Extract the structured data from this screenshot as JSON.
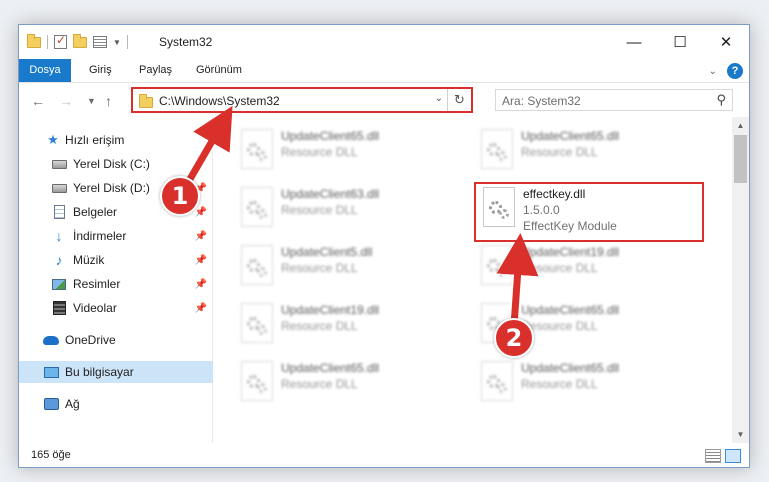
{
  "window": {
    "title": "System32",
    "controls": {
      "minimize": "—",
      "maximize": "☐",
      "close": "✕"
    }
  },
  "ribbon": {
    "tabs": [
      "Dosya",
      "Giriş",
      "Paylaş",
      "Görünüm"
    ],
    "help": "?"
  },
  "address": {
    "path": "C:\\Windows\\System32",
    "search_placeholder": "Ara: System32"
  },
  "sidebar": {
    "items": [
      {
        "label": "Hızlı erişim",
        "icon": "star-icon",
        "pinned": false
      },
      {
        "label": "Yerel Disk (C:)",
        "icon": "drive-icon",
        "pinned": true
      },
      {
        "label": "Yerel Disk (D:)",
        "icon": "drive-icon",
        "pinned": true
      },
      {
        "label": "Belgeler",
        "icon": "documents-icon",
        "pinned": true
      },
      {
        "label": "İndirmeler",
        "icon": "downloads-icon",
        "pinned": true
      },
      {
        "label": "Müzik",
        "icon": "music-icon",
        "pinned": true
      },
      {
        "label": "Resimler",
        "icon": "pictures-icon",
        "pinned": true
      },
      {
        "label": "Videolar",
        "icon": "videos-icon",
        "pinned": true
      },
      {
        "label": "OneDrive",
        "icon": "onedrive-icon",
        "pinned": false
      },
      {
        "label": "Bu bilgisayar",
        "icon": "this-pc-icon",
        "pinned": false,
        "selected": true
      },
      {
        "label": "Ağ",
        "icon": "network-icon",
        "pinned": false
      }
    ]
  },
  "files": [
    {
      "name": "UpdateClient65.dll",
      "type": "Resource DLL"
    },
    {
      "name": "UpdateClient65.dll",
      "type": "Resource DLL"
    },
    {
      "name": "UpdateClient63.dll",
      "type": "Resource DLL"
    },
    {
      "name": "effectkey.dll",
      "version": "1.5.0.0",
      "type": "EffectKey Module",
      "highlighted": true
    },
    {
      "name": "UpdateClient5.dll",
      "type": "Resource DLL"
    },
    {
      "name": "UpdateClient19.dll",
      "type": "Resource DLL"
    },
    {
      "name": "UpdateClient19.dll",
      "type": "Resource DLL"
    },
    {
      "name": "UpdateClient65.dll",
      "type": "Resource DLL"
    },
    {
      "name": "UpdateClient65.dll",
      "type": "Resource DLL"
    },
    {
      "name": "UpdateClient65.dll",
      "type": "Resource DLL"
    }
  ],
  "status": {
    "item_count": "165 öğe"
  },
  "annotations": {
    "step1": "1",
    "step2": "2",
    "color": "#d9302c"
  }
}
